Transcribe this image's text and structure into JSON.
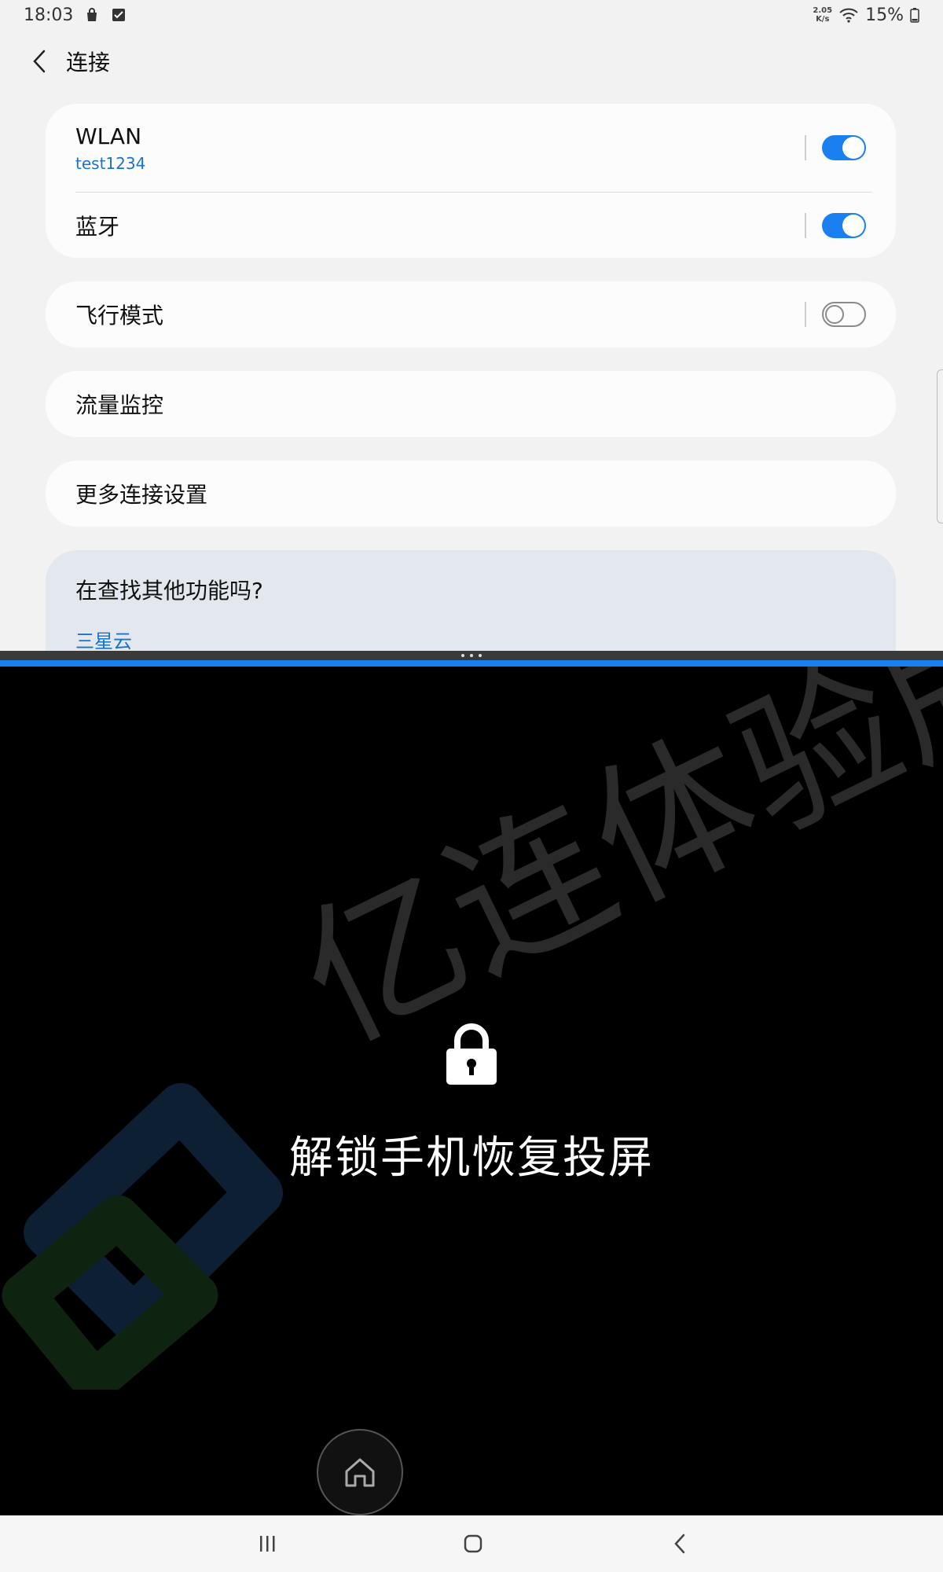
{
  "status_bar": {
    "time": "18:03",
    "net_speed_value": "2.05",
    "net_speed_unit": "K/s",
    "battery": "15%"
  },
  "header": {
    "title": "连接"
  },
  "settings": {
    "wlan": {
      "label": "WLAN",
      "network": "test1234",
      "enabled": true
    },
    "bluetooth": {
      "label": "蓝牙",
      "enabled": true
    },
    "airplane": {
      "label": "飞行模式",
      "enabled": false
    },
    "data_usage": {
      "label": "流量监控"
    },
    "more": {
      "label": "更多连接设置"
    }
  },
  "suggestion": {
    "title": "在查找其他功能吗?",
    "link": "三星云"
  },
  "cast_overlay": {
    "watermark": "亿连体验版",
    "message": "解锁手机恢复投屏"
  },
  "colors": {
    "accent": "#1a7ff0",
    "link": "#1a73c9",
    "background": "#f2f2f2"
  },
  "icons": {
    "back": "chevron-left-icon",
    "lock": "lock-icon",
    "home": "home-icon",
    "recents": "recents-icon",
    "nav_home": "circle-home-icon",
    "nav_back": "chevron-left-icon"
  }
}
